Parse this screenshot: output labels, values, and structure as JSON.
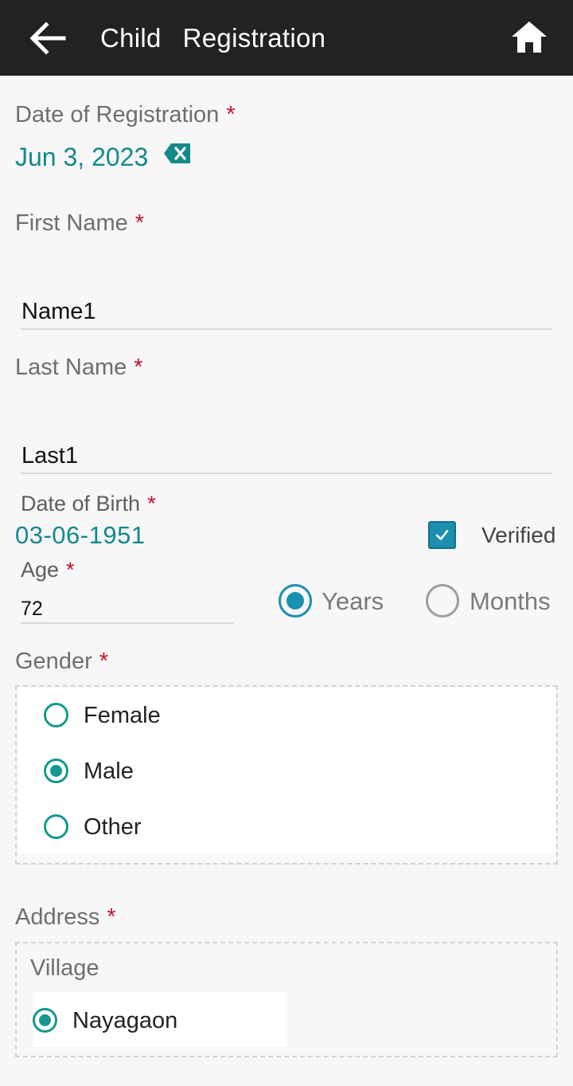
{
  "header": {
    "title": "Child  Registration",
    "icons": [
      "arrow-back-icon",
      "home-icon"
    ]
  },
  "registration_date": {
    "label": "Date of Registration",
    "required_marker": "*",
    "value": "Jun 3, 2023"
  },
  "first_name": {
    "label": "First Name",
    "required_marker": "*",
    "value": "Name1"
  },
  "last_name": {
    "label": "Last Name",
    "required_marker": "*",
    "value": "Last1"
  },
  "date_of_birth": {
    "label": "Date of Birth",
    "required_marker": "*",
    "value": "03-06-1951",
    "verified_label": "Verified",
    "verified_checked": true
  },
  "age": {
    "label": "Age",
    "required_marker": "*",
    "value": "72",
    "units": [
      {
        "label": "Years",
        "selected": true
      },
      {
        "label": "Months",
        "selected": false
      }
    ]
  },
  "gender": {
    "label": "Gender",
    "required_marker": "*",
    "options": [
      {
        "label": "Female",
        "selected": false
      },
      {
        "label": "Male",
        "selected": true
      },
      {
        "label": "Other",
        "selected": false
      }
    ]
  },
  "address": {
    "label": "Address",
    "required_marker": "*",
    "village_label": "Village",
    "villages": [
      {
        "label": "Nayagaon",
        "selected": true
      }
    ]
  },
  "colors": {
    "appbar": "#222222",
    "accent_teal": "#13898b",
    "accent_blue": "#1b8fb0",
    "required": "#c8102e"
  }
}
